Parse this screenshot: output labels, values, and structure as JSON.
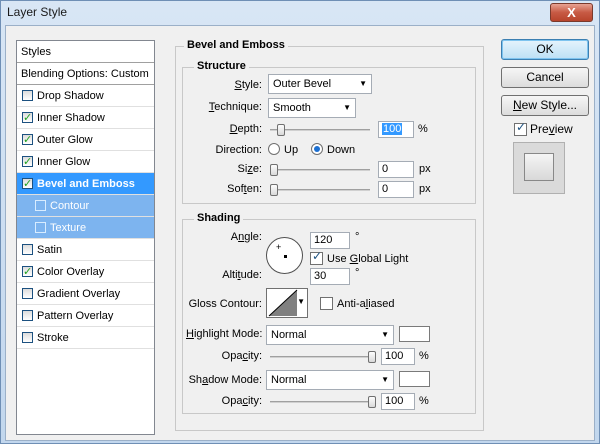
{
  "window": {
    "title": "Layer Style",
    "close_glyph": "X"
  },
  "styles_panel": {
    "items": [
      {
        "label": "Styles",
        "type": "heading"
      },
      {
        "label": "Blending Options: Custom",
        "type": "heading"
      },
      {
        "label": "Drop Shadow",
        "checked": false
      },
      {
        "label": "Inner Shadow",
        "checked": true
      },
      {
        "label": "Outer Glow",
        "checked": true
      },
      {
        "label": "Inner Glow",
        "checked": true
      },
      {
        "label": "Bevel and Emboss",
        "checked": true,
        "selected": true
      },
      {
        "label": "Contour",
        "checked": false,
        "sub": true
      },
      {
        "label": "Texture",
        "checked": false,
        "sub": true
      },
      {
        "label": "Satin",
        "checked": false
      },
      {
        "label": "Color Overlay",
        "checked": true
      },
      {
        "label": "Gradient Overlay",
        "checked": false
      },
      {
        "label": "Pattern Overlay",
        "checked": false
      },
      {
        "label": "Stroke",
        "checked": false
      }
    ]
  },
  "bevel": {
    "section_title": "Bevel and Emboss",
    "structure": {
      "title": "Structure",
      "style_label": "Style:",
      "style_value": "Outer Bevel",
      "technique_label": "Technique:",
      "technique_value": "Smooth",
      "depth_label": "Depth:",
      "depth_value": "100",
      "depth_unit": "%",
      "depth_level": 0.0,
      "direction_label": "Direction:",
      "direction_up": "Up",
      "direction_down": "Down",
      "size_label": "Size:",
      "size_value": "0",
      "size_unit": "px",
      "soften_label": "Soften:",
      "soften_value": "0",
      "soften_unit": "px"
    },
    "shading": {
      "title": "Shading",
      "angle_label": "Angle:",
      "angle_value": "120",
      "angle_unit": "°",
      "global_light_label": "Use Global Light",
      "global_light_checked": true,
      "altitude_label": "Altitude:",
      "altitude_value": "30",
      "altitude_unit": "°",
      "gloss_label": "Gloss Contour:",
      "anti_aliased_label": "Anti-aliased",
      "anti_aliased_checked": false,
      "highlight_mode_label": "Highlight Mode:",
      "highlight_mode_value": "Normal",
      "highlight_color": "#ffffff",
      "highlight_opacity_label": "Opacity:",
      "highlight_opacity_value": "100",
      "highlight_opacity_unit": "%",
      "shadow_mode_label": "Shadow Mode:",
      "shadow_mode_value": "Normal",
      "shadow_color": "#ffffff",
      "shadow_opacity_label": "Opacity:",
      "shadow_opacity_value": "100",
      "shadow_opacity_unit": "%"
    }
  },
  "buttons": {
    "ok": "OK",
    "cancel": "Cancel",
    "new_style": "New Style...",
    "preview_label": "Preview",
    "preview_checked": true
  }
}
